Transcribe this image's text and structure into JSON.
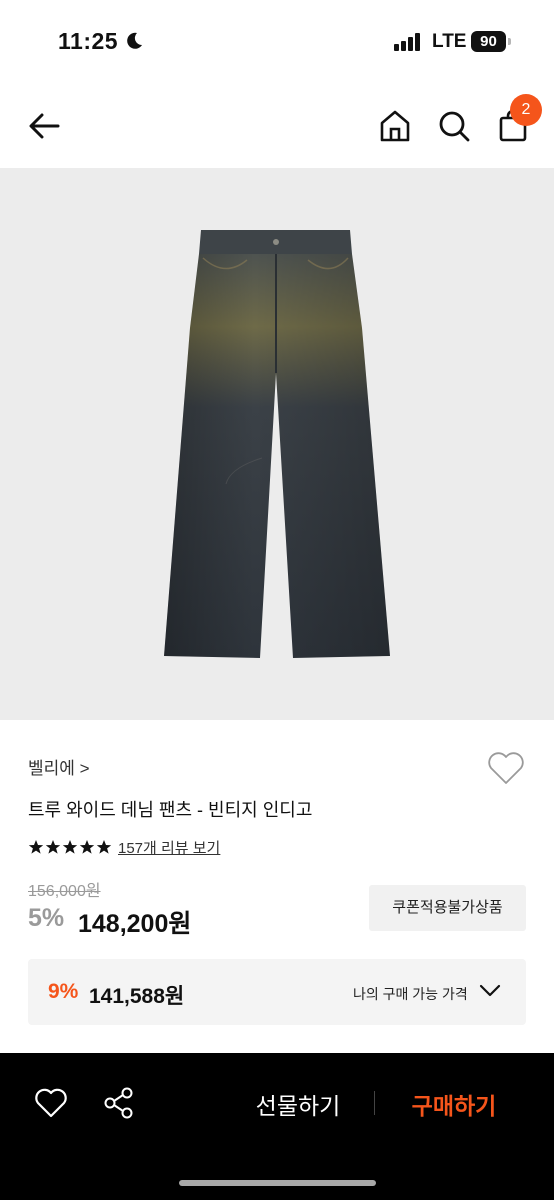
{
  "status_bar": {
    "time": "11:25",
    "network": "LTE",
    "battery": "90"
  },
  "nav": {
    "cart_count": "2",
    "back_icon": "arrow-left-icon",
    "home_icon": "home-icon",
    "search_icon": "search-icon",
    "cart_icon": "shopping-bag-icon"
  },
  "product": {
    "brand": "벨리에 >",
    "name": "트루 와이드 데님 팬츠 - 빈티지 인디고",
    "rating_stars": 5,
    "review_link": "157개 리뷰 보기",
    "original_price": "156,000원",
    "discount_rate": "5%",
    "sale_price": "148,200원",
    "coupon_tag": "쿠폰적용불가상품"
  },
  "my_price": {
    "rate": "9%",
    "price": "141,588원",
    "label": "나의 구매 가능 가격"
  },
  "bottom_bar": {
    "gift_label": "선물하기",
    "buy_label": "구매하기"
  },
  "colors": {
    "accent": "#f5551b",
    "image_bg": "#ececec",
    "bar_bg": "#000000"
  }
}
